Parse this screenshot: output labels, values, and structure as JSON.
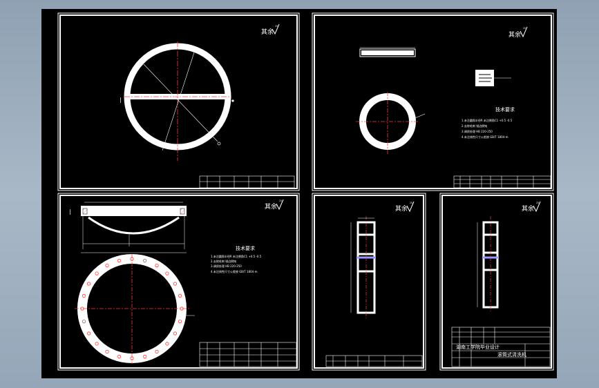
{
  "colors": {
    "background_outer": "#9aabbd",
    "canvas": "#000000",
    "line": "#ffffff",
    "centerline": "#ff3b3b",
    "dimension": "#9a9aff"
  },
  "sheets": {
    "top_left": {
      "roughness_note": "其余",
      "roughness_value": "25"
    },
    "top_right": {
      "roughness_note": "其余",
      "roughness_value": "25",
      "tech_title": "技术要求",
      "tech_lines": [
        "1.未注圆角半径R 未注倒角C1 +0.5 -0.5",
        "2.去除毛刺 锐边倒钝",
        "3.调质处理 HB 220-250",
        "4.未注线性尺寸公差按 GB/T 1804-m"
      ]
    },
    "bottom_left": {
      "roughness_note": "其余",
      "roughness_value": "25",
      "tech_title": "技术要求",
      "tech_lines": [
        "1.未注圆角半径R 未注倒角C1 +0.5 -0.5",
        "2.去除毛刺 锐边倒钝",
        "3.调质处理 HB 220-250",
        "4.未注线性尺寸公差按 GB/T 1804-m"
      ]
    },
    "bottom_middle": {
      "roughness_note": "其余",
      "roughness_value": "25"
    },
    "bottom_right": {
      "roughness_note": "其余",
      "roughness_value": "25",
      "title_school": "湖南工学院毕业设计",
      "title_product": "滚筒式清洗机"
    }
  }
}
